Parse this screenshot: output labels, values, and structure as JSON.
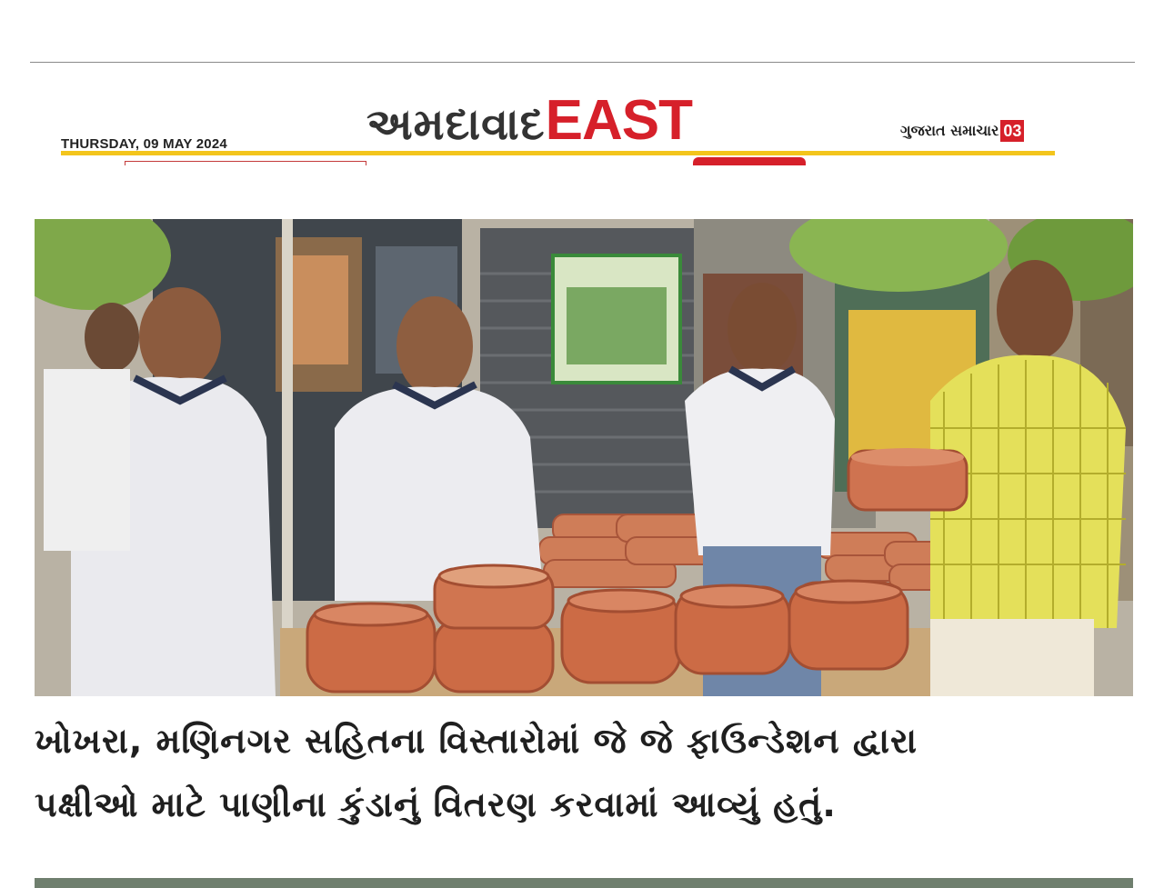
{
  "masthead": {
    "date": "THURSDAY, 09 MAY 2024",
    "section_gujarati": "અમદાવાદ",
    "section_english": "EAST",
    "paper_name": "ગુજરાત સમાચાર",
    "page_number": "03"
  },
  "article": {
    "caption_line1": "ખોખરા, મણિનગર સહિતના વિસ્તારોમાં જે જે ફાઉન્ડેશન દ્વારા",
    "caption_line2": "પક્ષીઓ માટે પાણીના કુંડાનું વિતરણ કરવામાં આવ્યું હતું."
  },
  "colors": {
    "accent_red": "#d6202a",
    "rule_yellow": "#f3c51c",
    "clay_pot": "#c86a45"
  }
}
